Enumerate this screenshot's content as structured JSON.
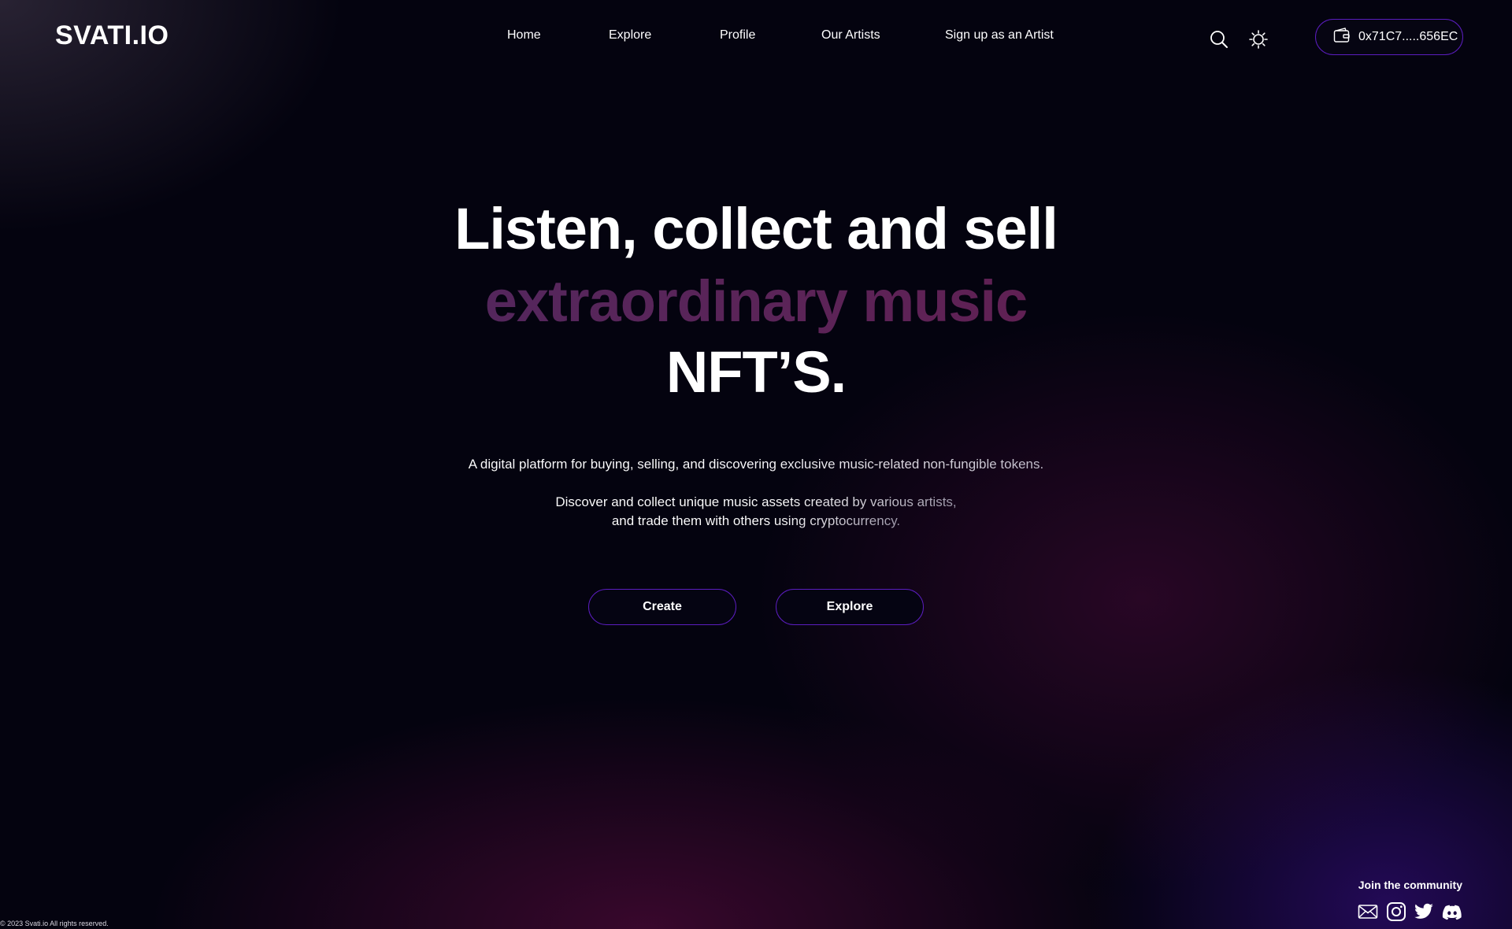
{
  "header": {
    "logo": "SVATI.IO",
    "nav": [
      "Home",
      "Explore",
      "Profile",
      "Our Artists",
      "Sign up as an Artist"
    ],
    "wallet_address": "0x71C7.....656EC"
  },
  "hero": {
    "line1": "Listen, collect and sell",
    "line2": "extraordinary music",
    "line3": "NFT’S.",
    "subtitle": "A digital platform for buying, selling, and discovering exclusive music-related non-fungible tokens.",
    "description_line1": "Discover and collect unique music assets created by various artists,",
    "description_line2": "and trade them with others using cryptocurrency.",
    "buttons": [
      "Create",
      "Explore"
    ]
  },
  "footer": {
    "community_label": "Join the community",
    "social_icons": [
      "mail-icon",
      "instagram-icon",
      "twitter-icon",
      "discord-icon"
    ],
    "copyright": "© 2023 Svati.io All rights reserved."
  },
  "colors": {
    "background": "#04030f",
    "accent_border": "#5b1dbf",
    "gradient_purple": "#4a2a64",
    "gradient_magenta": "#6a1a4c"
  }
}
